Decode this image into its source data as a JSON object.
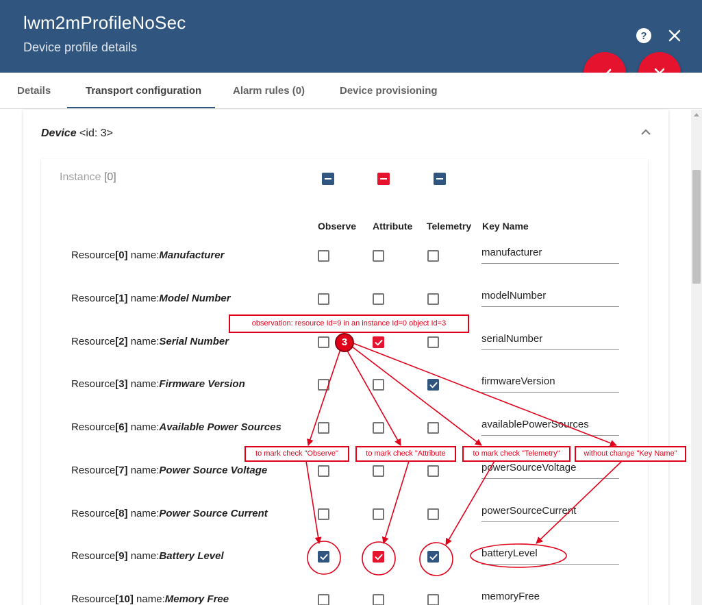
{
  "header": {
    "title": "lwm2mProfileNoSec",
    "subtitle": "Device profile details",
    "color": "#305680"
  },
  "tabs": [
    {
      "label": "Details"
    },
    {
      "label": "Transport configuration"
    },
    {
      "label": "Alarm rules (0)"
    },
    {
      "label": "Device provisioning"
    }
  ],
  "object": {
    "name": "Device",
    "id_text": "<id: 3>"
  },
  "instance": {
    "label_prefix": "Instance ",
    "label_bracket": "[0]"
  },
  "columns": {
    "observe": "Observe",
    "attribute": "Attribute",
    "telemetry": "Telemetry",
    "key_name": "Key Name"
  },
  "resources": [
    {
      "prefix": "Resource",
      "index": "[0]",
      "sep": " name:",
      "name": "Manufacturer",
      "observe": false,
      "attribute": false,
      "telemetry": false,
      "key": "manufacturer"
    },
    {
      "prefix": "Resource",
      "index": "[1]",
      "sep": " name:",
      "name": "Model Number",
      "observe": false,
      "attribute": false,
      "telemetry": false,
      "key": "modelNumber"
    },
    {
      "prefix": "Resource",
      "index": "[2]",
      "sep": " name:",
      "name": "Serial Number",
      "observe": false,
      "attribute": true,
      "telemetry": false,
      "key": "serialNumber"
    },
    {
      "prefix": "Resource",
      "index": "[3]",
      "sep": " name:",
      "name": "Firmware Version",
      "observe": false,
      "attribute": false,
      "telemetry": true,
      "key": "firmwareVersion"
    },
    {
      "prefix": "Resource",
      "index": "[6]",
      "sep": " name:",
      "name": "Available Power Sources",
      "observe": false,
      "attribute": false,
      "telemetry": false,
      "key": "availablePowerSources"
    },
    {
      "prefix": "Resource",
      "index": "[7]",
      "sep": " name:",
      "name": "Power Source Voltage",
      "observe": false,
      "attribute": false,
      "telemetry": false,
      "key": "powerSourceVoltage"
    },
    {
      "prefix": "Resource",
      "index": "[8]",
      "sep": " name:",
      "name": "Power Source Current",
      "observe": false,
      "attribute": false,
      "telemetry": false,
      "key": "powerSourceCurrent"
    },
    {
      "prefix": "Resource",
      "index": "[9]",
      "sep": " name:",
      "name": "Battery Level",
      "observe": true,
      "attribute": true,
      "telemetry": true,
      "key": "batteryLevel"
    },
    {
      "prefix": "Resource",
      "index": "[10]",
      "sep": " name:",
      "name": "Memory Free",
      "observe": false,
      "attribute": false,
      "telemetry": false,
      "key": "memoryFree"
    }
  ],
  "annotations": {
    "badge": "3",
    "observation": "observation: resource Id=9 in an instance Id=0 object Id=3",
    "mark_observe": "to mark check \"Observe\"",
    "mark_attribute": "to mark check \"Attribute",
    "mark_telemetry": "to mark check \"Telemetry\"",
    "no_change_key": "without change \"Key Name\""
  },
  "colors": {
    "primary": "#305680",
    "accent": "#e5132d",
    "annotation": "#e0001a"
  }
}
